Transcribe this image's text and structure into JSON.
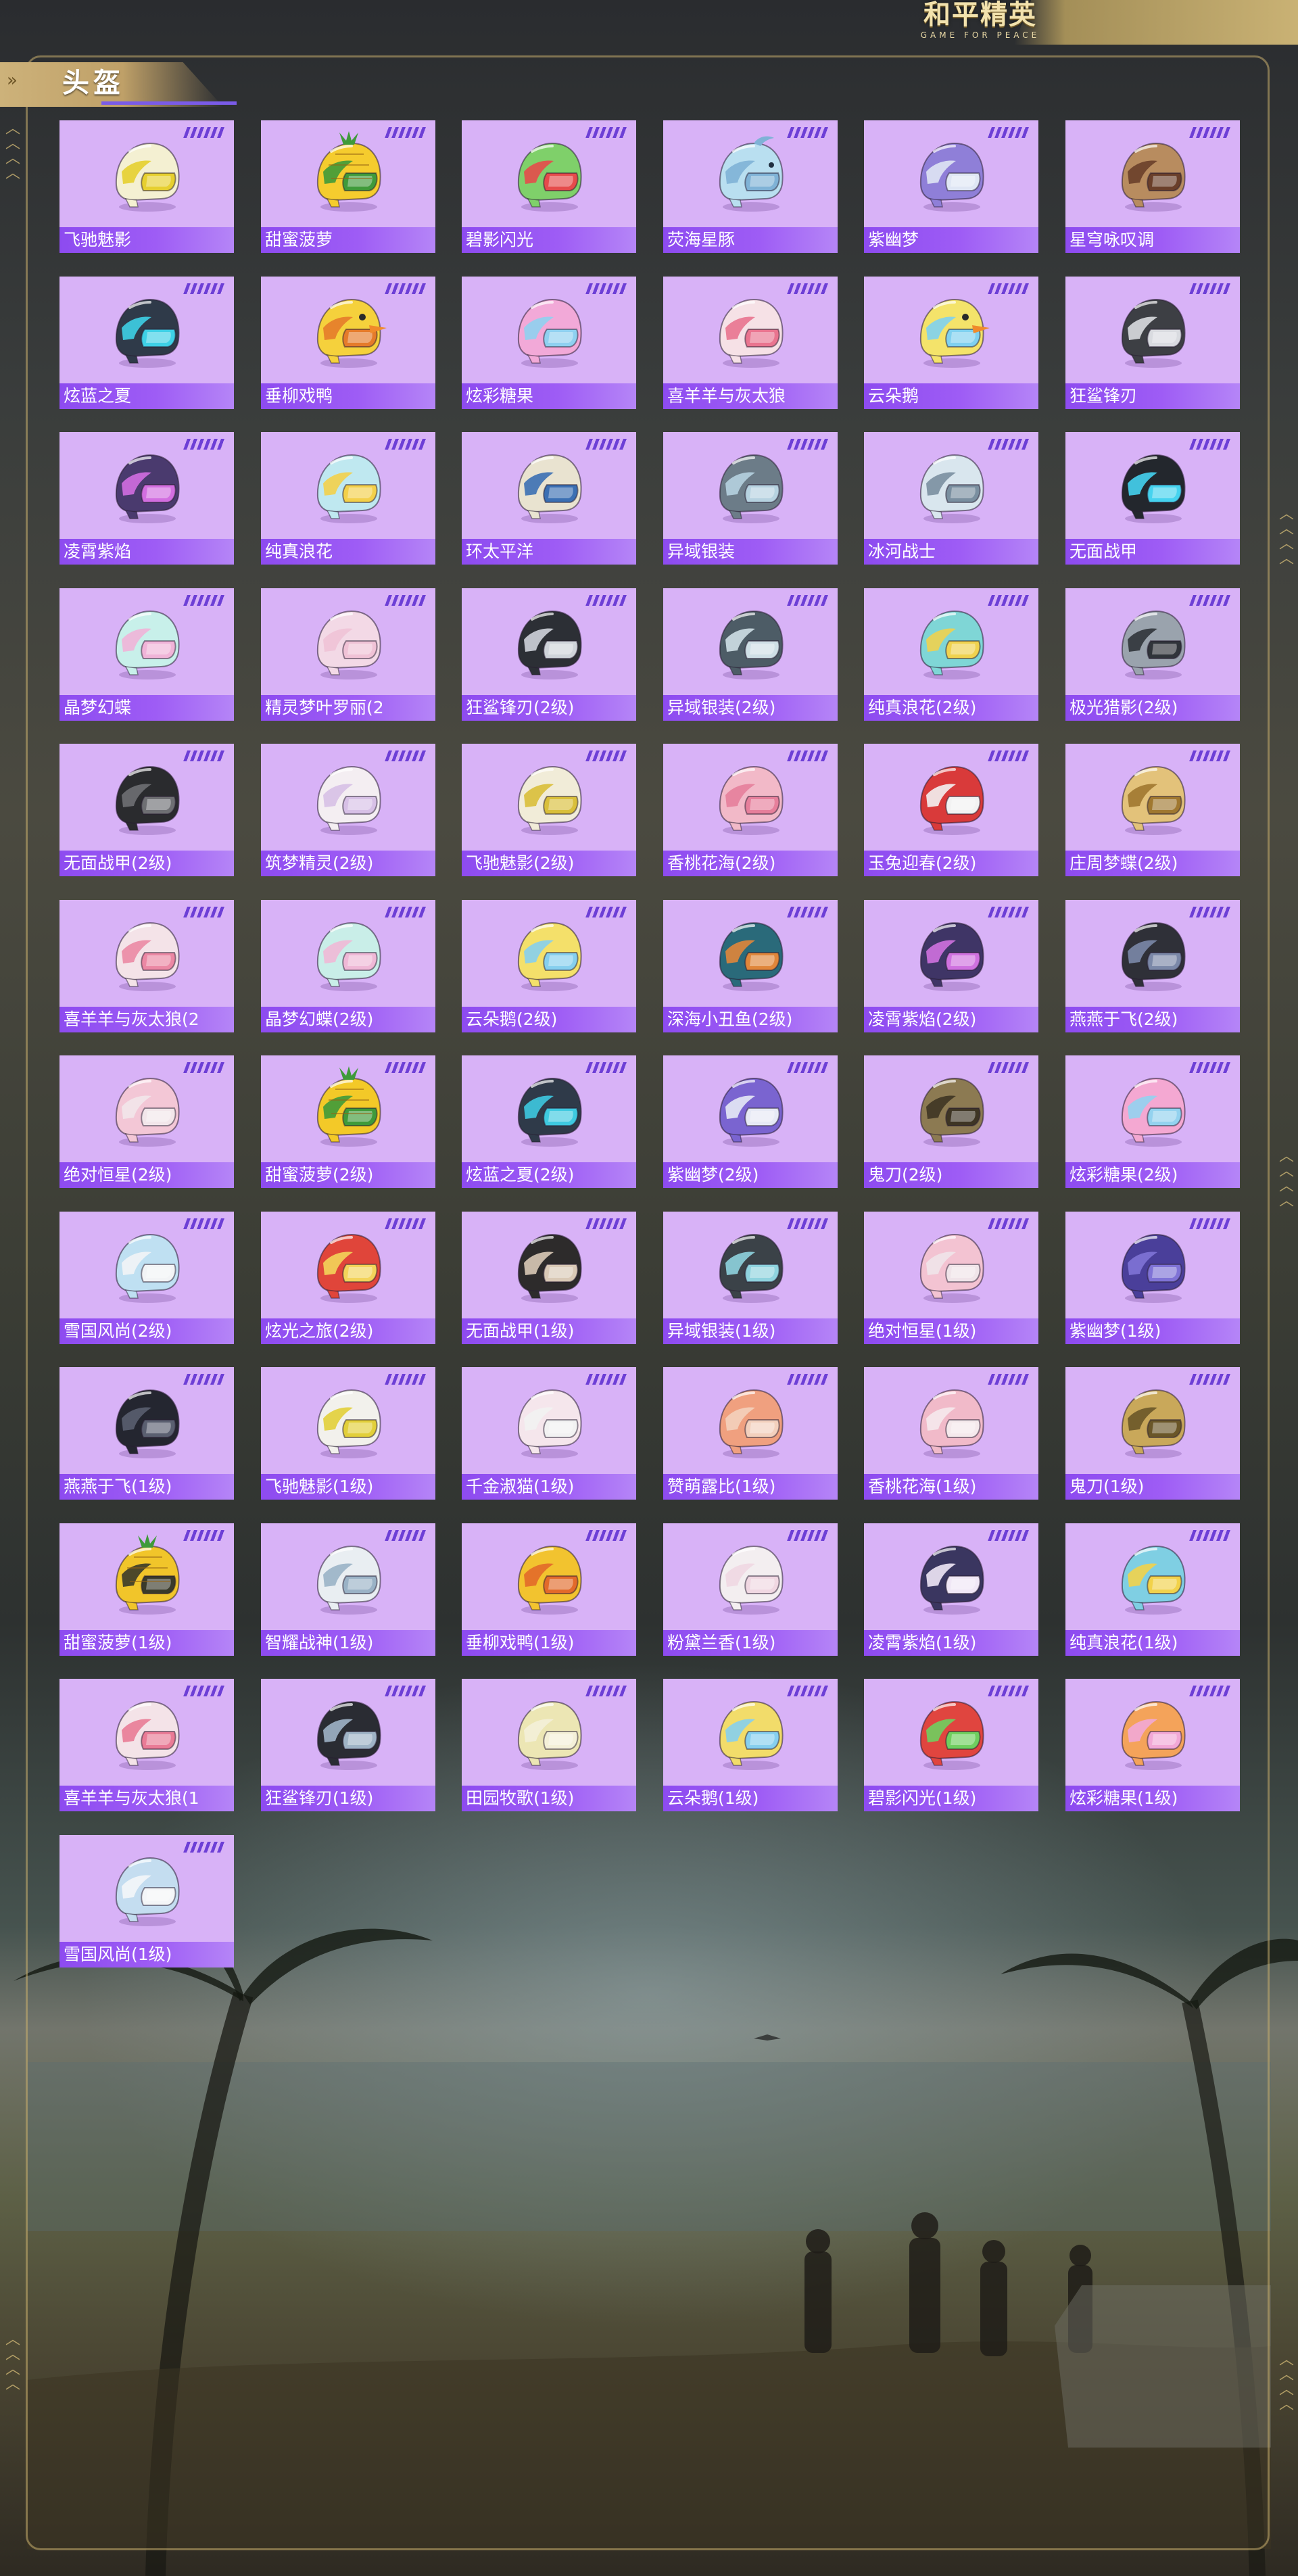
{
  "header": {
    "logo_main": "和平精英",
    "logo_sub": "GAME FOR PEACE"
  },
  "section": {
    "title": "头盔"
  },
  "helmets": [
    {
      "name": "飞驰魅影",
      "helmet_color": "#f4f0d2",
      "accent_color": "#e6cf2f",
      "icon": "helmet-icon"
    },
    {
      "name": "甜蜜菠萝",
      "helmet_color": "#f5cc2e",
      "accent_color": "#3f9a3a",
      "icon": "pineapple-helmet-icon"
    },
    {
      "name": "碧影闪光",
      "helmet_color": "#7fd06a",
      "accent_color": "#e54b4b",
      "icon": "helmet-icon"
    },
    {
      "name": "荧海星豚",
      "helmet_color": "#b9dff0",
      "accent_color": "#7fb2d6",
      "icon": "dolphin-helmet-icon"
    },
    {
      "name": "紫幽梦",
      "helmet_color": "#8f7fd8",
      "accent_color": "#dfe6f4",
      "icon": "helmet-icon"
    },
    {
      "name": "星穹咏叹调",
      "helmet_color": "#b88c5f",
      "accent_color": "#6a3f2a",
      "icon": "helmet-icon"
    },
    {
      "name": "炫蓝之夏",
      "helmet_color": "#2f3a49",
      "accent_color": "#3ed0e6",
      "icon": "helmet-icon"
    },
    {
      "name": "垂柳戏鸭",
      "helmet_color": "#f5d13c",
      "accent_color": "#e57b2a",
      "icon": "duck-helmet-icon"
    },
    {
      "name": "炫彩糖果",
      "helmet_color": "#f2a9d8",
      "accent_color": "#8fd0f0",
      "icon": "helmet-icon"
    },
    {
      "name": "喜羊羊与灰太狼",
      "helmet_color": "#f6e1e6",
      "accent_color": "#e9748f",
      "icon": "helmet-icon"
    },
    {
      "name": "云朵鹅",
      "helmet_color": "#f4e36a",
      "accent_color": "#7fd0ef",
      "icon": "goose-helmet-icon"
    },
    {
      "name": "狂鲨锋刃",
      "helmet_color": "#3d3f44",
      "accent_color": "#d9dbe0",
      "icon": "helmet-icon"
    },
    {
      "name": "凌霄紫焰",
      "helmet_color": "#4a3a6e",
      "accent_color": "#d26ee0",
      "icon": "helmet-icon"
    },
    {
      "name": "纯真浪花",
      "helmet_color": "#bfe8f0",
      "accent_color": "#f3d04a",
      "icon": "helmet-icon"
    },
    {
      "name": "环太平洋",
      "helmet_color": "#e9e3d0",
      "accent_color": "#3b6fb3",
      "icon": "helmet-icon"
    },
    {
      "name": "异域银装",
      "helmet_color": "#6c7c88",
      "accent_color": "#b6d2e0",
      "icon": "helmet-icon"
    },
    {
      "name": "冰河战士",
      "helmet_color": "#d9e6ee",
      "accent_color": "#7a8fa0",
      "icon": "helmet-icon"
    },
    {
      "name": "无面战甲",
      "helmet_color": "#23272d",
      "accent_color": "#45d3ef",
      "icon": "helmet-icon"
    },
    {
      "name": "晶梦幻蝶",
      "helmet_color": "#c8f0ea",
      "accent_color": "#f0b4d8",
      "icon": "helmet-icon"
    },
    {
      "name": "精灵梦叶罗丽(2",
      "helmet_color": "#f3d9e6",
      "accent_color": "#f0c2d6",
      "icon": "helmet-icon"
    },
    {
      "name": "狂鲨锋刃(2级)",
      "helmet_color": "#2c2f35",
      "accent_color": "#cfd3da",
      "icon": "helmet-icon"
    },
    {
      "name": "异域银装(2级)",
      "helmet_color": "#4d5c66",
      "accent_color": "#cfdfe6",
      "icon": "helmet-icon"
    },
    {
      "name": "纯真浪花(2级)",
      "helmet_color": "#7fd6d6",
      "accent_color": "#f0d24f",
      "icon": "helmet-icon"
    },
    {
      "name": "极光猎影(2级)",
      "helmet_color": "#9aa3ad",
      "accent_color": "#30343a",
      "icon": "helmet-icon"
    },
    {
      "name": "无面战甲(2级)",
      "helmet_color": "#2a2b2e",
      "accent_color": "#6e6f73",
      "icon": "helmet-icon"
    },
    {
      "name": "筑梦精灵(2级)",
      "helmet_color": "#f4eef2",
      "accent_color": "#d7c0e6",
      "icon": "helmet-icon"
    },
    {
      "name": "飞驰魅影(2级)",
      "helmet_color": "#f1ecd8",
      "accent_color": "#d9bf3a",
      "icon": "helmet-icon"
    },
    {
      "name": "香桃花海(2级)",
      "helmet_color": "#f2b9c8",
      "accent_color": "#e67f9b",
      "icon": "helmet-icon"
    },
    {
      "name": "玉兔迎春(2级)",
      "helmet_color": "#d93a3a",
      "accent_color": "#f2f2f2",
      "icon": "helmet-icon"
    },
    {
      "name": "庄周梦蝶(2级)",
      "helmet_color": "#e3c27a",
      "accent_color": "#a07830",
      "icon": "helmet-icon"
    },
    {
      "name": "喜羊羊与灰太狼(2",
      "helmet_color": "#f4e3e8",
      "accent_color": "#eb88a4",
      "icon": "helmet-icon"
    },
    {
      "name": "晶梦幻蝶(2级)",
      "helmet_color": "#c9eee8",
      "accent_color": "#efb8d6",
      "icon": "helmet-icon"
    },
    {
      "name": "云朵鹅(2级)",
      "helmet_color": "#f4e06a",
      "accent_color": "#86cfee",
      "icon": "helmet-icon"
    },
    {
      "name": "深海小丑鱼(2级)",
      "helmet_color": "#2a6a7a",
      "accent_color": "#e0863a",
      "icon": "helmet-icon"
    },
    {
      "name": "凌霄紫焰(2级)",
      "helmet_color": "#3f3566",
      "accent_color": "#cf71df",
      "icon": "helmet-icon"
    },
    {
      "name": "燕燕于飞(2级)",
      "helmet_color": "#2f3038",
      "accent_color": "#7b88a8",
      "icon": "helmet-icon"
    },
    {
      "name": "绝对恒星(2级)",
      "helmet_color": "#f3c7d6",
      "accent_color": "#f2e6ea",
      "icon": "helmet-icon"
    },
    {
      "name": "甜蜜菠萝(2级)",
      "helmet_color": "#f3c928",
      "accent_color": "#3f9a3a",
      "icon": "pineapple-helmet-icon"
    },
    {
      "name": "炫蓝之夏(2级)",
      "helmet_color": "#2f3a49",
      "accent_color": "#3ec9e0",
      "icon": "helmet-icon"
    },
    {
      "name": "紫幽梦(2级)",
      "helmet_color": "#7a64d0",
      "accent_color": "#e6e9f5",
      "icon": "helmet-icon"
    },
    {
      "name": "鬼刀(2级)",
      "helmet_color": "#8c7a52",
      "accent_color": "#3e3524",
      "icon": "helmet-icon"
    },
    {
      "name": "炫彩糖果(2级)",
      "helmet_color": "#f4a8d2",
      "accent_color": "#93d2ef",
      "icon": "helmet-icon"
    },
    {
      "name": "雪国风尚(2级)",
      "helmet_color": "#bfe0f2",
      "accent_color": "#f2f4f6",
      "icon": "helmet-icon"
    },
    {
      "name": "炫光之旅(2级)",
      "helmet_color": "#e0453a",
      "accent_color": "#f3d45a",
      "icon": "helmet-icon"
    },
    {
      "name": "无面战甲(1级)",
      "helmet_color": "#2d2b2b",
      "accent_color": "#d9c9b6",
      "icon": "helmet-icon"
    },
    {
      "name": "异域银装(1级)",
      "helmet_color": "#3b4248",
      "accent_color": "#8fd3de",
      "icon": "helmet-icon"
    },
    {
      "name": "绝对恒星(1级)",
      "helmet_color": "#f3c3d2",
      "accent_color": "#f0e4e9",
      "icon": "helmet-icon"
    },
    {
      "name": "紫幽梦(1级)",
      "helmet_color": "#4a3f9a",
      "accent_color": "#7f73d6",
      "icon": "helmet-icon"
    },
    {
      "name": "燕燕于飞(1级)",
      "helmet_color": "#242630",
      "accent_color": "#5a5f70",
      "icon": "helmet-icon"
    },
    {
      "name": "飞驰魅影(1级)",
      "helmet_color": "#f2f1ec",
      "accent_color": "#e2cf3a",
      "icon": "helmet-icon"
    },
    {
      "name": "千金淑猫(1级)",
      "helmet_color": "#f5e6ec",
      "accent_color": "#f2f2f2",
      "icon": "helmet-icon"
    },
    {
      "name": "赞萌露比(1级)",
      "helmet_color": "#f0a07f",
      "accent_color": "#f3d0bd",
      "icon": "helmet-icon"
    },
    {
      "name": "香桃花海(1级)",
      "helmet_color": "#f1bac9",
      "accent_color": "#f5e9ec",
      "icon": "helmet-icon"
    },
    {
      "name": "鬼刀(1级)",
      "helmet_color": "#c9a85a",
      "accent_color": "#6a5628",
      "icon": "helmet-icon"
    },
    {
      "name": "甜蜜菠萝(1级)",
      "helmet_color": "#f1c52a",
      "accent_color": "#3a3a2a",
      "icon": "pineapple-helmet-icon"
    },
    {
      "name": "智耀战神(1级)",
      "helmet_color": "#e9eef2",
      "accent_color": "#9ab2c6",
      "icon": "helmet-icon"
    },
    {
      "name": "垂柳戏鸭(1级)",
      "helmet_color": "#f2c32f",
      "accent_color": "#e26a2a",
      "icon": "helmet-icon"
    },
    {
      "name": "粉黛兰香(1级)",
      "helmet_color": "#f3eef0",
      "accent_color": "#f0d7e2",
      "icon": "helmet-icon"
    },
    {
      "name": "凌霄紫焰(1级)",
      "helmet_color": "#3a3660",
      "accent_color": "#f0e7f6",
      "icon": "helmet-icon"
    },
    {
      "name": "纯真浪花(1级)",
      "helmet_color": "#7fcfe3",
      "accent_color": "#f2d24a",
      "icon": "helmet-icon"
    },
    {
      "name": "喜羊羊与灰太狼(1",
      "helmet_color": "#f4e3e8",
      "accent_color": "#e97b96",
      "icon": "helmet-icon"
    },
    {
      "name": "狂鲨锋刃(1级)",
      "helmet_color": "#2a2c33",
      "accent_color": "#9fb3c6",
      "icon": "helmet-icon"
    },
    {
      "name": "田园牧歌(1级)",
      "helmet_color": "#ece6b4",
      "accent_color": "#f4f0d8",
      "icon": "helmet-icon"
    },
    {
      "name": "云朵鹅(1级)",
      "helmet_color": "#f2dc6a",
      "accent_color": "#86cfee",
      "icon": "helmet-icon"
    },
    {
      "name": "碧影闪光(1级)",
      "helmet_color": "#e0453f",
      "accent_color": "#6fcf5f",
      "icon": "helmet-icon"
    },
    {
      "name": "炫彩糖果(1级)",
      "helmet_color": "#f4a35a",
      "accent_color": "#f2a8d6",
      "icon": "helmet-icon"
    },
    {
      "name": "雪国风尚(1级)",
      "helmet_color": "#c4ddf0",
      "accent_color": "#f4f6f8",
      "icon": "helmet-icon"
    }
  ]
}
